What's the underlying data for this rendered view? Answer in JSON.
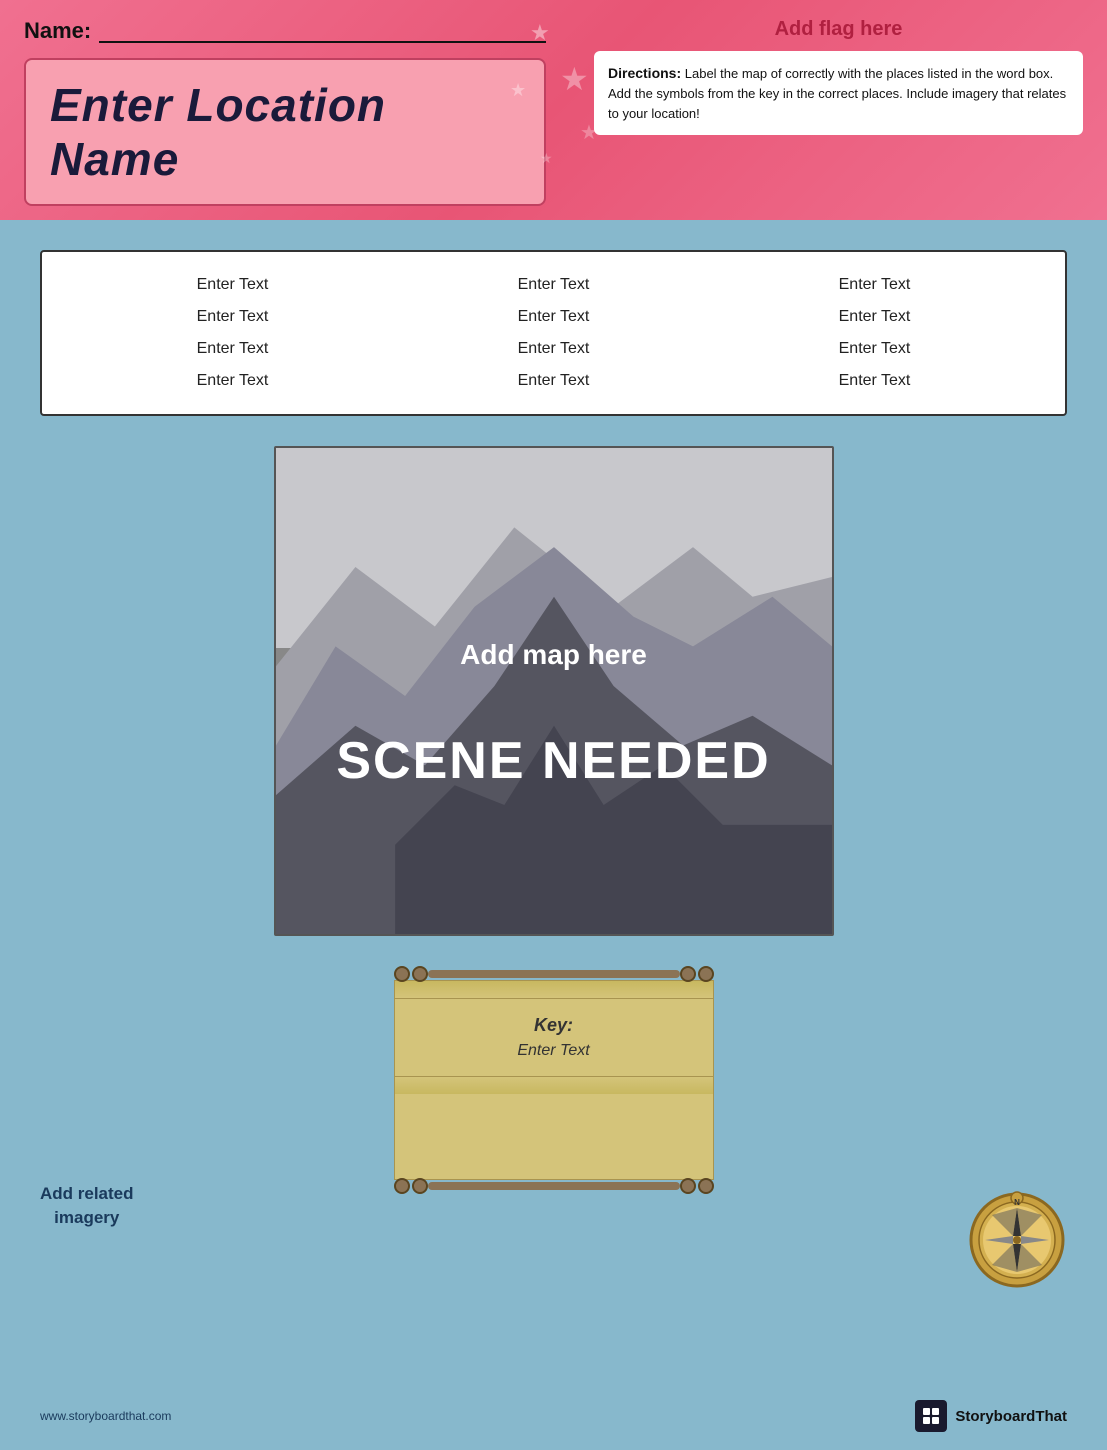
{
  "header": {
    "name_label": "Name:",
    "flag_placeholder": "Add flag here",
    "location_name": "Enter Location Name",
    "directions_label": "Directions:",
    "directions_text": " Label the map of  correctly with the places listed in the word box.  Add the symbols from the key in the correct places. Include imagery that relates to your location!"
  },
  "word_box": {
    "items": [
      "Enter Text",
      "Enter Text",
      "Enter Text",
      "Enter Text",
      "Enter Text",
      "Enter Text",
      "Enter Text",
      "Enter Text",
      "Enter Text",
      "Enter Text",
      "Enter Text",
      "Enter Text"
    ]
  },
  "map": {
    "add_map_text": "Add map here",
    "scene_needed_text": "SCENE NEEDED"
  },
  "key": {
    "title": "Key:",
    "enter_text": "Enter Text"
  },
  "sidebar": {
    "add_imagery": "Add related\nimagery"
  },
  "footer": {
    "url": "www.storyboardthat.com",
    "brand": "StoryboardThat"
  }
}
